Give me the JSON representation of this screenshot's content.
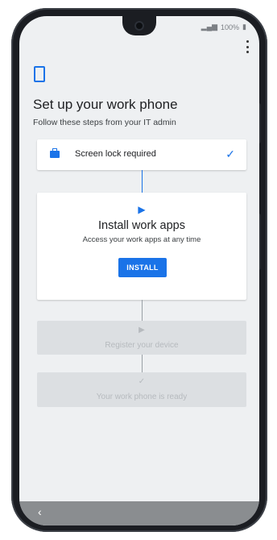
{
  "status_bar": {
    "signal_icon": "wifi-signal-icon",
    "battery_text": "100%",
    "battery_icon": "battery-icon"
  },
  "menu": {
    "icon": "more-vert-icon"
  },
  "header": {
    "device_icon": "phone-outline-icon",
    "title": "Set up your work phone",
    "subtitle": "Follow these steps from your IT admin"
  },
  "steps": {
    "step1": {
      "label": "Screen lock required",
      "icon": "briefcase-icon",
      "status_icon": "check-icon"
    },
    "step2": {
      "icon": "play-store-icon",
      "title": "Install work apps",
      "description": "Access your work apps at any time",
      "button_label": "INSTALL"
    },
    "step3": {
      "icon": "play-store-icon",
      "label": "Register your device"
    },
    "step4": {
      "icon": "check-icon",
      "label": "Your work phone is ready"
    }
  },
  "nav": {
    "back_icon": "chevron-left-icon"
  },
  "colors": {
    "accent": "#1a73e8",
    "disabled_bg": "#dcdfe2",
    "disabled_text": "#b6babe",
    "screen_bg": "#eef0f2"
  }
}
